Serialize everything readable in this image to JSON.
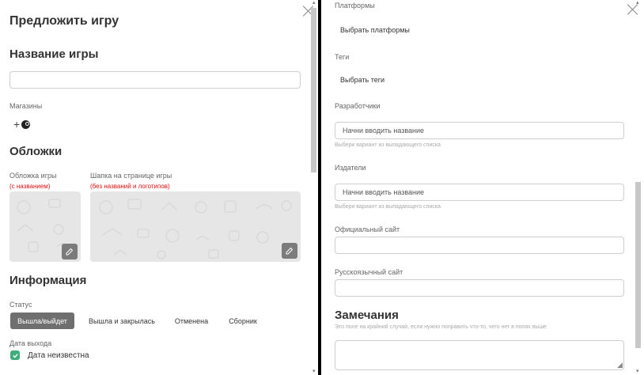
{
  "left": {
    "title": "Предложить игру",
    "game_name_heading": "Название игры",
    "game_name_value": "",
    "stores_label": "Магазины",
    "stores_add_symbol": "+",
    "covers_heading": "Обложки",
    "cover_label": "Обложка игры",
    "cover_note": "(с названием)",
    "header_label": "Шапка на странице игры",
    "header_note": "(без названий и логотипов)",
    "info_heading": "Информация",
    "status_label": "Статус",
    "status_options": [
      "Вышла/выйдет",
      "Вышла и закрылась",
      "Отменена",
      "Сборник"
    ],
    "status_selected": "Вышла/выйдет",
    "release_label": "Дата выхода",
    "date_unknown_label": "Дата неизвестна",
    "date_unknown_checked": true
  },
  "right": {
    "platforms_label": "Платформы",
    "platforms_button": "Выбрать платформы",
    "tags_label": "Теги",
    "tags_button": "Выбрать теги",
    "developers_label": "Разработчики",
    "developers_placeholder": "Начни вводить название",
    "developers_hint": "Выбери вариант из выпадающего списка",
    "publishers_label": "Издатели",
    "publishers_placeholder": "Начни вводить название",
    "publishers_hint": "Выбери вариант из выпадающего списка",
    "official_site_label": "Официальный сайт",
    "official_site_value": "",
    "ru_site_label": "Русскоязычный сайт",
    "ru_site_value": "",
    "notes_heading": "Замечания",
    "notes_hint": "Это поле на крайний случай, если нужно поправить что-то, чего нет в полях выше",
    "notes_value": ""
  },
  "colors": {
    "accent_chip": "#6f6f6f",
    "required_note": "#dd1111",
    "checkbox": "#3fae7b"
  }
}
